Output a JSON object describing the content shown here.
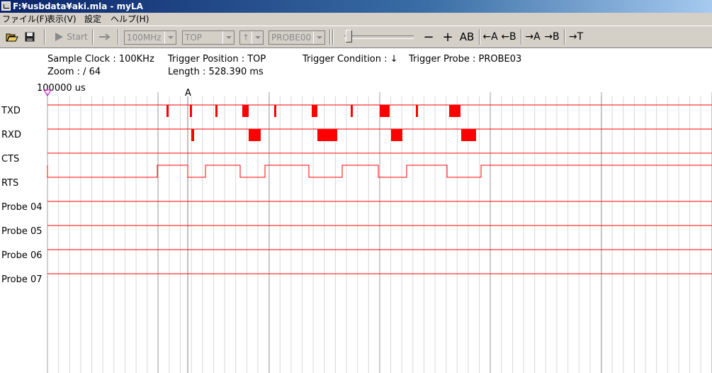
{
  "window": {
    "title": "F:¥usbdata¥aki.mla - myLA"
  },
  "menu": [
    {
      "label": "ファイル(F)"
    },
    {
      "label": "表示(V)"
    },
    {
      "label": "設定"
    },
    {
      "label": "ヘルプ(H)"
    }
  ],
  "toolbar": {
    "open_icon": "folder-open-icon",
    "save_icon": "floppy-disk-icon",
    "start_label": "Start",
    "clock_select": "100MHz",
    "position_select": "TOP",
    "edge_select": "↑",
    "probe_select": "PROBE00",
    "zoom_out": "−",
    "zoom_in": "+",
    "ab_label": "AB",
    "cursor_buttons": [
      "←A",
      "←B",
      "→A",
      "→B",
      "→T"
    ]
  },
  "info": {
    "sample_clock": "Sample Clock : 100KHz",
    "zoom": "Zoom : /  64",
    "trigger_position": "Trigger Position : TOP",
    "length": "Length : 528.390 ms",
    "trigger_condition": "Trigger Condition : ↓",
    "trigger_probe": "Trigger Probe : PROBE03"
  },
  "timeline": {
    "start_label": "100000 us",
    "marker_a": "A"
  },
  "colors": {
    "signal": "#ff0000",
    "grid_major": "#a0a0a0",
    "grid_minor": "#d8d8d8",
    "title_bar": "#0a246a"
  },
  "channels": [
    {
      "name": "TXD"
    },
    {
      "name": "RXD"
    },
    {
      "name": "CTS"
    },
    {
      "name": "RTS"
    },
    {
      "name": "Probe 04"
    },
    {
      "name": "Probe 05"
    },
    {
      "name": "Probe 06"
    },
    {
      "name": "Probe 07"
    }
  ]
}
